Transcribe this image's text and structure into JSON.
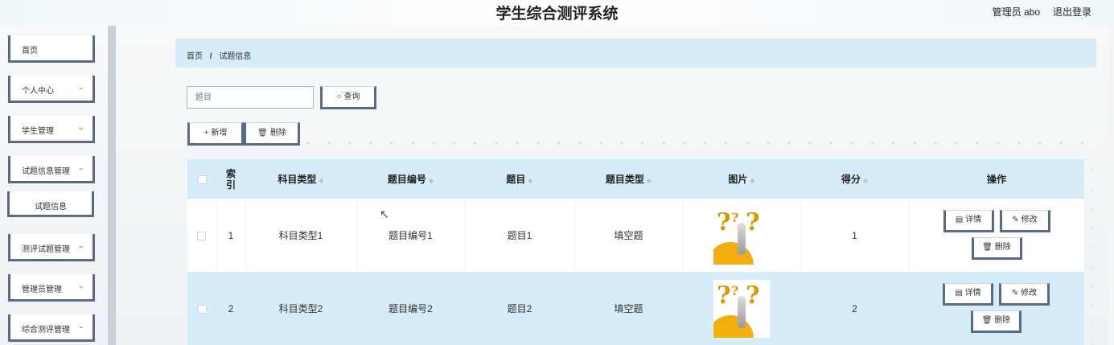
{
  "header": {
    "title": "学生综合测评系统",
    "user": "管理员 abo",
    "logout": "退出登录"
  },
  "sidebar": {
    "items": [
      {
        "label": "首页",
        "chevron": false
      },
      {
        "label": "个人中心",
        "chevron": true
      },
      {
        "label": "学生管理",
        "chevron": true
      },
      {
        "label": "试题信息管理",
        "chevron": true
      },
      {
        "label": "试题信息",
        "chevron": false
      },
      {
        "label": "测评试题管理",
        "chevron": true
      },
      {
        "label": "管理员管理",
        "chevron": true
      },
      {
        "label": "综合测评管理",
        "chevron": true
      }
    ]
  },
  "breadcrumb": {
    "home": "首页",
    "separator": "/",
    "current": "试题信息"
  },
  "search": {
    "placeholder": "题目",
    "button": "查询"
  },
  "toolbar": {
    "add": "新增",
    "delete": "删除"
  },
  "table": {
    "headers": [
      "索引",
      "科目类型",
      "题目编号",
      "题目",
      "题目类型",
      "图片",
      "得分",
      "操作"
    ],
    "rows": [
      {
        "index": "1",
        "subject_type": "科目类型1",
        "question_no": "题目编号1",
        "question": "题目1",
        "question_type": "填空题",
        "score": "1"
      },
      {
        "index": "2",
        "subject_type": "科目类型2",
        "question_no": "题目编号2",
        "question": "题目2",
        "question_type": "填空题",
        "score": "2"
      }
    ],
    "actions": {
      "detail": "详情",
      "edit": "修改",
      "delete": "删除"
    }
  },
  "icons": {
    "search": "search-icon",
    "add": "plus-icon",
    "delete": "trash-icon",
    "detail": "document-icon",
    "edit": "pencil-icon",
    "picture": "question-marks-image"
  },
  "colors": {
    "accent": "#5b6b86",
    "header_bg": "#d6ecf8"
  }
}
